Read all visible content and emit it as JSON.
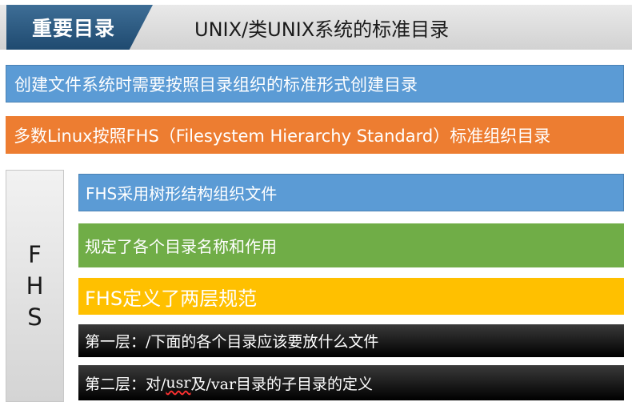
{
  "header": {
    "tag": "重要目录",
    "title": "UNIX/类UNIX系统的标准目录"
  },
  "points": {
    "p1": "创建文件系统时需要按照目录组织的标准形式创建目录",
    "p2": "多数Linux按照FHS（Filesystem Hierarchy Standard）标准组织目录"
  },
  "fhs": {
    "side_label": "F\nH\nS",
    "items": [
      "FHS采用树形结构组织文件",
      "规定了各个目录名称和作用",
      "FHS定义了两层规范",
      "第一层：/下面的各个目录应该要放什么文件"
    ],
    "level2": {
      "prefix": "第二层：对/",
      "usr": "usr",
      "suffix": "及/var目录的子目录的定义"
    }
  },
  "colors": {
    "blue": "#5b9bd5",
    "orange": "#ed7d31",
    "green": "#70ad47",
    "gold": "#ffc000",
    "navy": "#1f4a70"
  }
}
